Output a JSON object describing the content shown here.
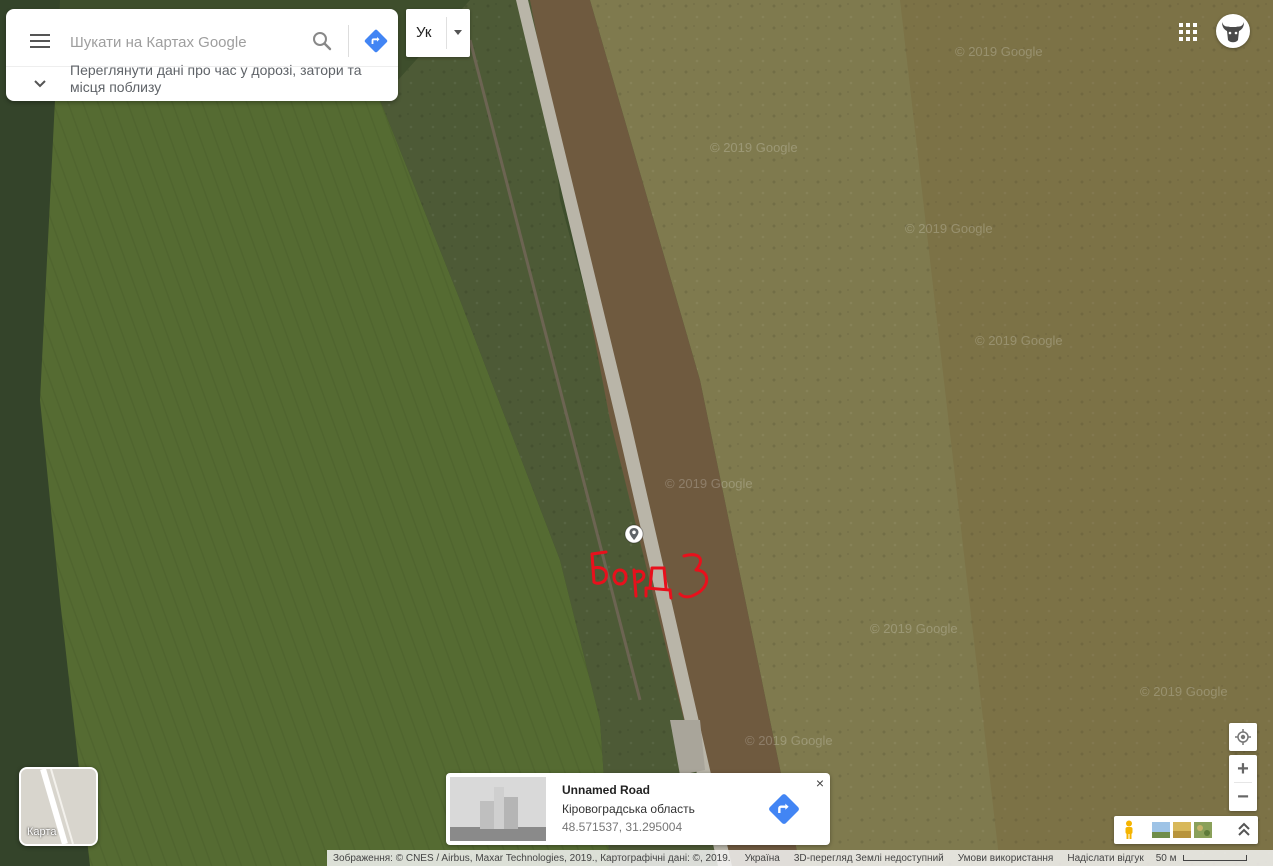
{
  "search": {
    "placeholder": "Шукати на Картах Google",
    "traffic_text": "Переглянути дані про час у дорозі, затори та місця поблизу"
  },
  "language": {
    "label": "Ук"
  },
  "annotation": {
    "text": "Борд 3",
    "color": "#e8101c"
  },
  "watermark": "© 2019 Google",
  "layer_toggle": {
    "label": "Карта"
  },
  "place": {
    "title": "Unnamed Road",
    "region": "Кіровоградська область",
    "coords": "48.571537, 31.295004",
    "close": "×"
  },
  "zoom": {
    "in": "+",
    "out": "−"
  },
  "footer": {
    "imagery": "Зображення: © CNES / Airbus, Maxar Technologies, 2019., Картографічні дані: ©, 2019.",
    "country": "Україна",
    "earth": "3D-перегляд Землі недоступний",
    "terms": "Умови використання",
    "feedback": "Надіслати відгук",
    "scale": "50 м"
  },
  "colors": {
    "accent": "#4285f4",
    "marker": "#ffffff"
  }
}
